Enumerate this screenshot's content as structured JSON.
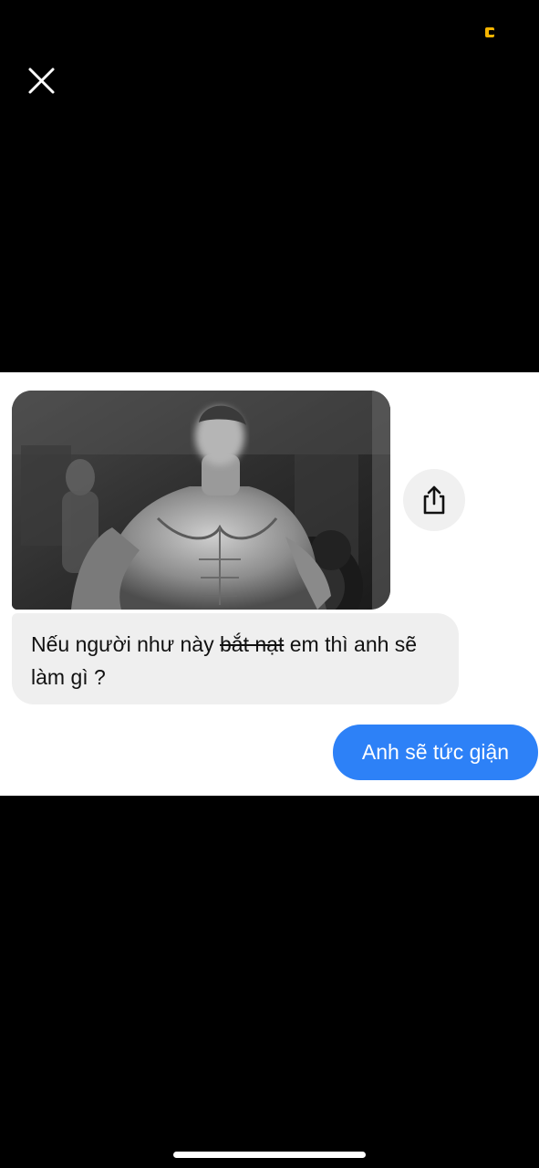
{
  "status_bar": {
    "indicator_icon": "status-indicator-icon",
    "indicator_color": "#f5b400"
  },
  "toolbar": {
    "close_icon": "close-icon"
  },
  "message_photo": {
    "icon": "photo-image",
    "share_icon": "share-icon"
  },
  "message_received": {
    "text_before": "Nếu người như này ",
    "text_struck": "bắt nạt",
    "text_after": " em thì anh sẽ làm gì ?"
  },
  "message_sent": {
    "text": "Anh sẽ tức giận",
    "color": "#2d81f7"
  },
  "colors": {
    "bubble_received": "#efefef",
    "background": "#000000"
  }
}
